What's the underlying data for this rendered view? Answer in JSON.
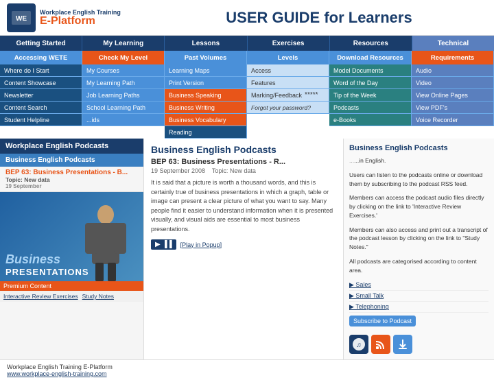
{
  "header": {
    "logo_top": "Workplace English Training",
    "logo_bottom_e": "E",
    "logo_bottom_platform": "-Platform",
    "title": "USER GUIDE for Learners"
  },
  "nav": {
    "items": [
      {
        "label": "Getting Started"
      },
      {
        "label": "My Learning"
      },
      {
        "label": "Lessons"
      },
      {
        "label": "Exercises"
      },
      {
        "label": "Resources"
      },
      {
        "label": "Technical"
      }
    ]
  },
  "dropdown": {
    "cols": [
      {
        "label": "Accessing WETE"
      },
      {
        "label": "Check My Level"
      },
      {
        "label": "Past Volumes"
      },
      {
        "label": "Levels"
      },
      {
        "label": "Download Resources"
      },
      {
        "label": "Requirements"
      }
    ],
    "row2": [
      {
        "label": "Where do I Start"
      },
      {
        "label": "My Courses"
      },
      {
        "label": "Learning Maps"
      },
      {
        "label": "Access"
      },
      {
        "label": "Model Documents"
      },
      {
        "label": "Audio"
      }
    ],
    "row3": [
      {
        "label": "Content Showcase"
      },
      {
        "label": "My Learning Path"
      },
      {
        "label": "Print Version"
      },
      {
        "label": "Features"
      },
      {
        "label": "Word of the Day"
      },
      {
        "label": "Video"
      }
    ],
    "row4": [
      {
        "label": "Newsletter"
      },
      {
        "label": "Job Learning Paths"
      },
      {
        "label": "Business Speaking"
      },
      {
        "label": "Marking/Feedback"
      },
      {
        "label": "Tip of the Week"
      },
      {
        "label": "View Online Pages"
      }
    ],
    "row5": [
      {
        "label": "Content Search"
      },
      {
        "label": "School Learning Path"
      },
      {
        "label": "Business Writing"
      },
      {
        "label": ""
      },
      {
        "label": "Podcasts"
      },
      {
        "label": "View PDF's"
      }
    ],
    "row6": [
      {
        "label": "Student Helpline"
      },
      {
        "label": "...ids"
      },
      {
        "label": "Business Vocabulary"
      },
      {
        "label": ""
      },
      {
        "label": "e-Books"
      },
      {
        "label": "Voice Recorder"
      }
    ],
    "row7": [
      {
        "label": ""
      },
      {
        "label": ""
      },
      {
        "label": "Reading"
      },
      {
        "label": ""
      },
      {
        "label": ""
      },
      {
        "label": ""
      }
    ]
  },
  "sidebar": {
    "title": "Workplace English Podcasts",
    "section": "Business English Podcasts",
    "episode_title": "BEP 63: Business Presentations - B...",
    "episode_sub": "Topic: New data",
    "episode_date": "19 September",
    "image_business": "Business",
    "image_presentations": "PRESENTATIONS",
    "premium_label": "Premium Content",
    "link1": "Interactive Review Exercises",
    "link2": "Study Notes"
  },
  "main": {
    "title": "Business English Podcasts",
    "episode_title": "BEP 63: Business Presentations - R...",
    "episode_meta_date": "19 September 2008",
    "episode_meta_topic": "Topic: New data",
    "episode_text1": "It is said that a picture is worth a thousand words, and this is certainly true of business presentations in which a graph, table or image can present a clear picture of what you want to say. Many people find it easier to understand information when it is presented visually, and visual aids are essential to most business presentations.",
    "play_label": "▶ ▐▐",
    "play_popup": "[Play in Popup]"
  },
  "right_panel": {
    "title": "Business English Podcasts",
    "intro": "...in English.",
    "text1": "Users can listen to the podcasts online or download them by subscribing to the podcast RSS feed.",
    "text2": "Members can access the podcast audio files directly by clicking on the link to 'Interactive Review Exercises.'",
    "text3": "Members can also access and print out a transcript of the podcast lesson by clicking on the link to \"Study Notes.\"",
    "text4": "All podcasts are categorised according to content area.",
    "episode_list": [
      "▶ Sales",
      "▶ Small Talk",
      "▶ Telephoning"
    ],
    "subscribe_btn": "Subscribe to Podcast"
  },
  "footer": {
    "company": "Workplace English Training E-Platform",
    "url": "www.workplace-english-training.com"
  }
}
